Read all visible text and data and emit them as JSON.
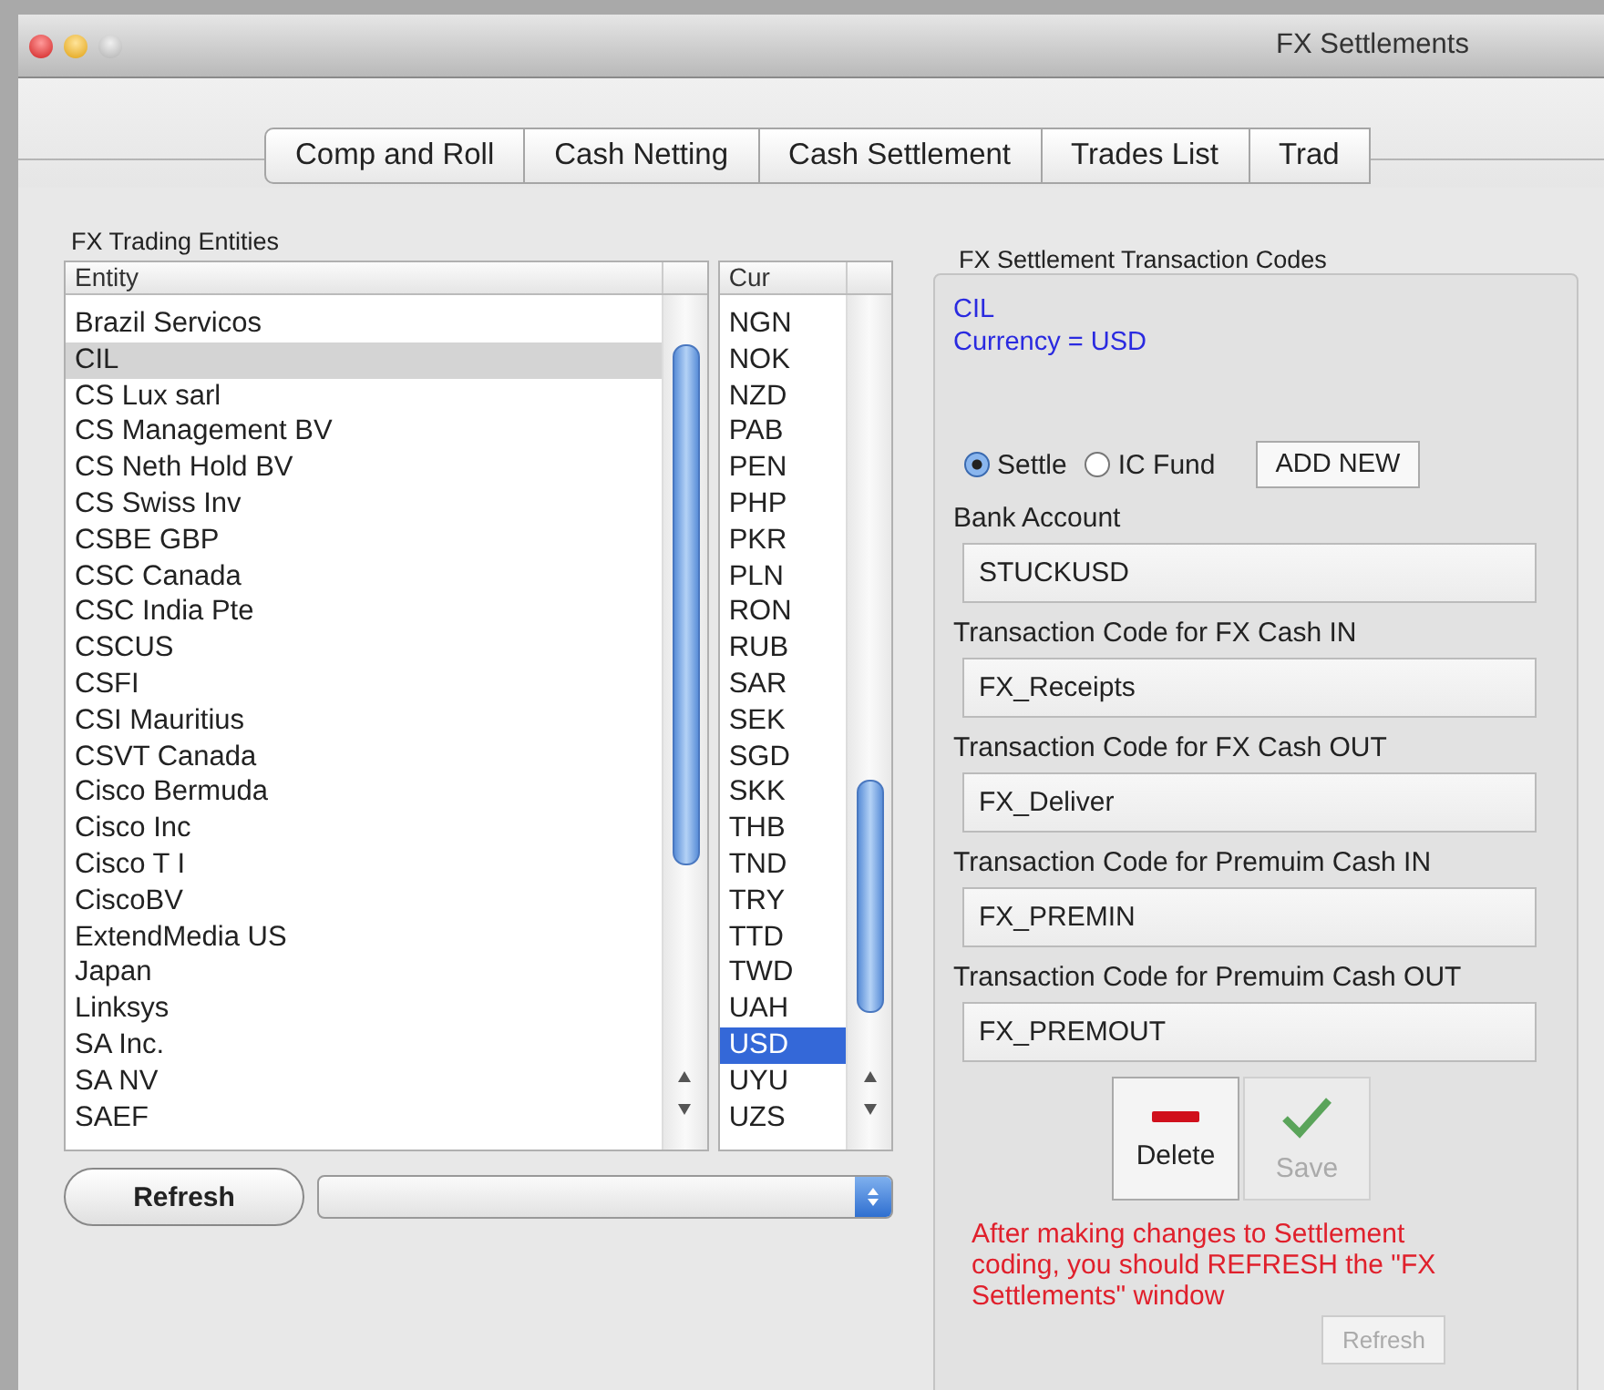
{
  "window": {
    "title": "FX Settlements"
  },
  "tabs": [
    {
      "label": "Comp and Roll",
      "selected": false
    },
    {
      "label": "Cash Netting",
      "selected": false
    },
    {
      "label": "Cash Settlement",
      "selected": false
    },
    {
      "label": "Trades List",
      "selected": false
    },
    {
      "label": "Trad",
      "selected": false
    }
  ],
  "entities_panel": {
    "title": "FX Trading Entities",
    "entity_list": {
      "column_header": "Entity",
      "rows": [
        {
          "label": "Brazil Servicos",
          "selected": false
        },
        {
          "label": "CIL",
          "selected": true
        },
        {
          "label": "CS Lux sarl",
          "selected": false
        },
        {
          "label": "CS Management BV",
          "selected": false
        },
        {
          "label": "CS Neth Hold BV",
          "selected": false
        },
        {
          "label": "CS Swiss Inv",
          "selected": false
        },
        {
          "label": "CSBE GBP",
          "selected": false
        },
        {
          "label": "CSC Canada",
          "selected": false
        },
        {
          "label": "CSC India Pte",
          "selected": false
        },
        {
          "label": "CSCUS",
          "selected": false
        },
        {
          "label": "CSFI",
          "selected": false
        },
        {
          "label": "CSI Mauritius",
          "selected": false
        },
        {
          "label": "CSVT Canada",
          "selected": false
        },
        {
          "label": "Cisco Bermuda",
          "selected": false
        },
        {
          "label": "Cisco Inc",
          "selected": false
        },
        {
          "label": "Cisco T I",
          "selected": false
        },
        {
          "label": "CiscoBV",
          "selected": false
        },
        {
          "label": "ExtendMedia US",
          "selected": false
        },
        {
          "label": "Japan",
          "selected": false
        },
        {
          "label": "Linksys",
          "selected": false
        },
        {
          "label": "SA Inc.",
          "selected": false
        },
        {
          "label": "SA NV",
          "selected": false
        },
        {
          "label": "SAEF",
          "selected": false
        }
      ]
    },
    "currency_list": {
      "column_header": "Cur",
      "rows": [
        {
          "label": "NGN",
          "selected": false
        },
        {
          "label": "NOK",
          "selected": false
        },
        {
          "label": "NZD",
          "selected": false
        },
        {
          "label": "PAB",
          "selected": false
        },
        {
          "label": "PEN",
          "selected": false
        },
        {
          "label": "PHP",
          "selected": false
        },
        {
          "label": "PKR",
          "selected": false
        },
        {
          "label": "PLN",
          "selected": false
        },
        {
          "label": "RON",
          "selected": false
        },
        {
          "label": "RUB",
          "selected": false
        },
        {
          "label": "SAR",
          "selected": false
        },
        {
          "label": "SEK",
          "selected": false
        },
        {
          "label": "SGD",
          "selected": false
        },
        {
          "label": "SKK",
          "selected": false
        },
        {
          "label": "THB",
          "selected": false
        },
        {
          "label": "TND",
          "selected": false
        },
        {
          "label": "TRY",
          "selected": false
        },
        {
          "label": "TTD",
          "selected": false
        },
        {
          "label": "TWD",
          "selected": false
        },
        {
          "label": "UAH",
          "selected": false
        },
        {
          "label": "USD",
          "selected": true
        },
        {
          "label": "UYU",
          "selected": false
        },
        {
          "label": "UZS",
          "selected": false
        }
      ]
    },
    "refresh_button": "Refresh"
  },
  "codes_panel": {
    "title": "FX Settlement Transaction Codes",
    "entity": "CIL",
    "currency_line": "Currency = USD",
    "options": [
      {
        "label": "Settle",
        "selected": true
      },
      {
        "label": "IC Fund",
        "selected": false
      }
    ],
    "add_button": "ADD NEW",
    "fields": [
      {
        "label": "Bank Account",
        "value": "STUCKUSD"
      },
      {
        "label": "Transaction Code for FX Cash IN",
        "value": "FX_Receipts"
      },
      {
        "label": "Transaction Code for FX Cash OUT",
        "value": "FX_Deliver"
      },
      {
        "label": "Transaction Code for Premuim Cash IN",
        "value": "FX_PREMIN"
      },
      {
        "label": "Transaction Code for Premuim Cash OUT",
        "value": "FX_PREMOUT"
      }
    ],
    "actions": [
      {
        "kind": "delete",
        "label": "Delete",
        "disabled": false
      },
      {
        "kind": "save",
        "label": "Save",
        "disabled": true
      }
    ],
    "notice": "After making changes to Settlement coding, you should REFRESH the \"FX Settlements\" window",
    "refresh_button": {
      "label": "Refresh",
      "disabled": true
    }
  }
}
